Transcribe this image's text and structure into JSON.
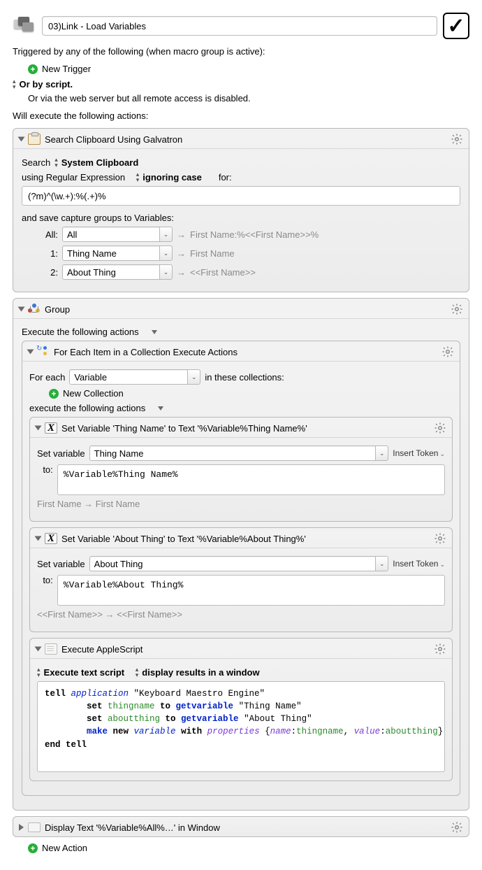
{
  "header": {
    "title": "03)Link - Load Variables"
  },
  "triggers": {
    "intro": "Triggered by any of the following (when macro group is active):",
    "new_trigger_label": "New Trigger",
    "or_by_script": "Or by script.",
    "webserver_note": "Or via the web server but all remote access is disabled."
  },
  "actions_intro": "Will execute the following actions:",
  "search_clip": {
    "title": "Search Clipboard Using Galvatron",
    "search_label": "Search",
    "source": "System Clipboard",
    "using_label": "using Regular Expression",
    "ignoring_case": "ignoring case",
    "for_label": "for:",
    "regex": "(?m)^(\\w.+):%(.+)%",
    "save_label": "and save capture groups to Variables:",
    "groups": [
      {
        "label": "All:",
        "field": "All",
        "hint": "First Name:%<<First Name>>%"
      },
      {
        "label": "1:",
        "field": "Thing Name",
        "hint": "First Name"
      },
      {
        "label": "2:",
        "field": "About Thing",
        "hint": "<<First Name>>"
      }
    ]
  },
  "group": {
    "title": "Group",
    "exec_label": "Execute the following actions",
    "foreach": {
      "title": "For Each Item in a Collection Execute Actions",
      "for_each_label": "For each",
      "variable": "Variable",
      "in_collections": "in these collections:",
      "new_collection": "New Collection",
      "exec_label": "execute the following actions"
    },
    "set1": {
      "title": "Set Variable 'Thing Name' to Text '%Variable%Thing Name%'",
      "set_variable_label": "Set variable",
      "field": "Thing Name",
      "insert_token": "Insert Token",
      "to_label": "to:",
      "to_value": "%Variable%Thing Name%",
      "hint": "First Name → First Name"
    },
    "set2": {
      "title": "Set Variable 'About Thing' to Text '%Variable%About Thing%'",
      "set_variable_label": "Set variable",
      "field": "About Thing",
      "insert_token": "Insert Token",
      "to_label": "to:",
      "to_value": "%Variable%About Thing%",
      "hint": "<<First Name>> → <<First Name>>"
    },
    "applescript": {
      "title": "Execute AppleScript",
      "opt1": "Execute text script",
      "opt2": "display results in a window",
      "code": {
        "l1a": "tell ",
        "l1b": "application",
        "l1c": " \"Keyboard Maestro Engine\"",
        "l2a": "        set ",
        "l2b": "thingname",
        "l2c": " to ",
        "l2d": "getvariable",
        "l2e": " \"Thing Name\"",
        "l3a": "        set ",
        "l3b": "aboutthing",
        "l3c": " to ",
        "l3d": "getvariable",
        "l3e": " \"About Thing\"",
        "l4a": "        make ",
        "l4b": "new ",
        "l4c": "variable",
        "l4d": " with ",
        "l4e": "properties",
        "l4f": " {",
        "l4g": "name",
        "l4h": ":",
        "l4i": "thingname",
        "l4j": ", ",
        "l4k": "value",
        "l4l": ":",
        "l4m": "aboutthing",
        "l4n": "}",
        "l5": "end tell"
      }
    }
  },
  "display_text": {
    "title": "Display Text '%Variable%All%…' in Window"
  },
  "new_action_label": "New Action"
}
